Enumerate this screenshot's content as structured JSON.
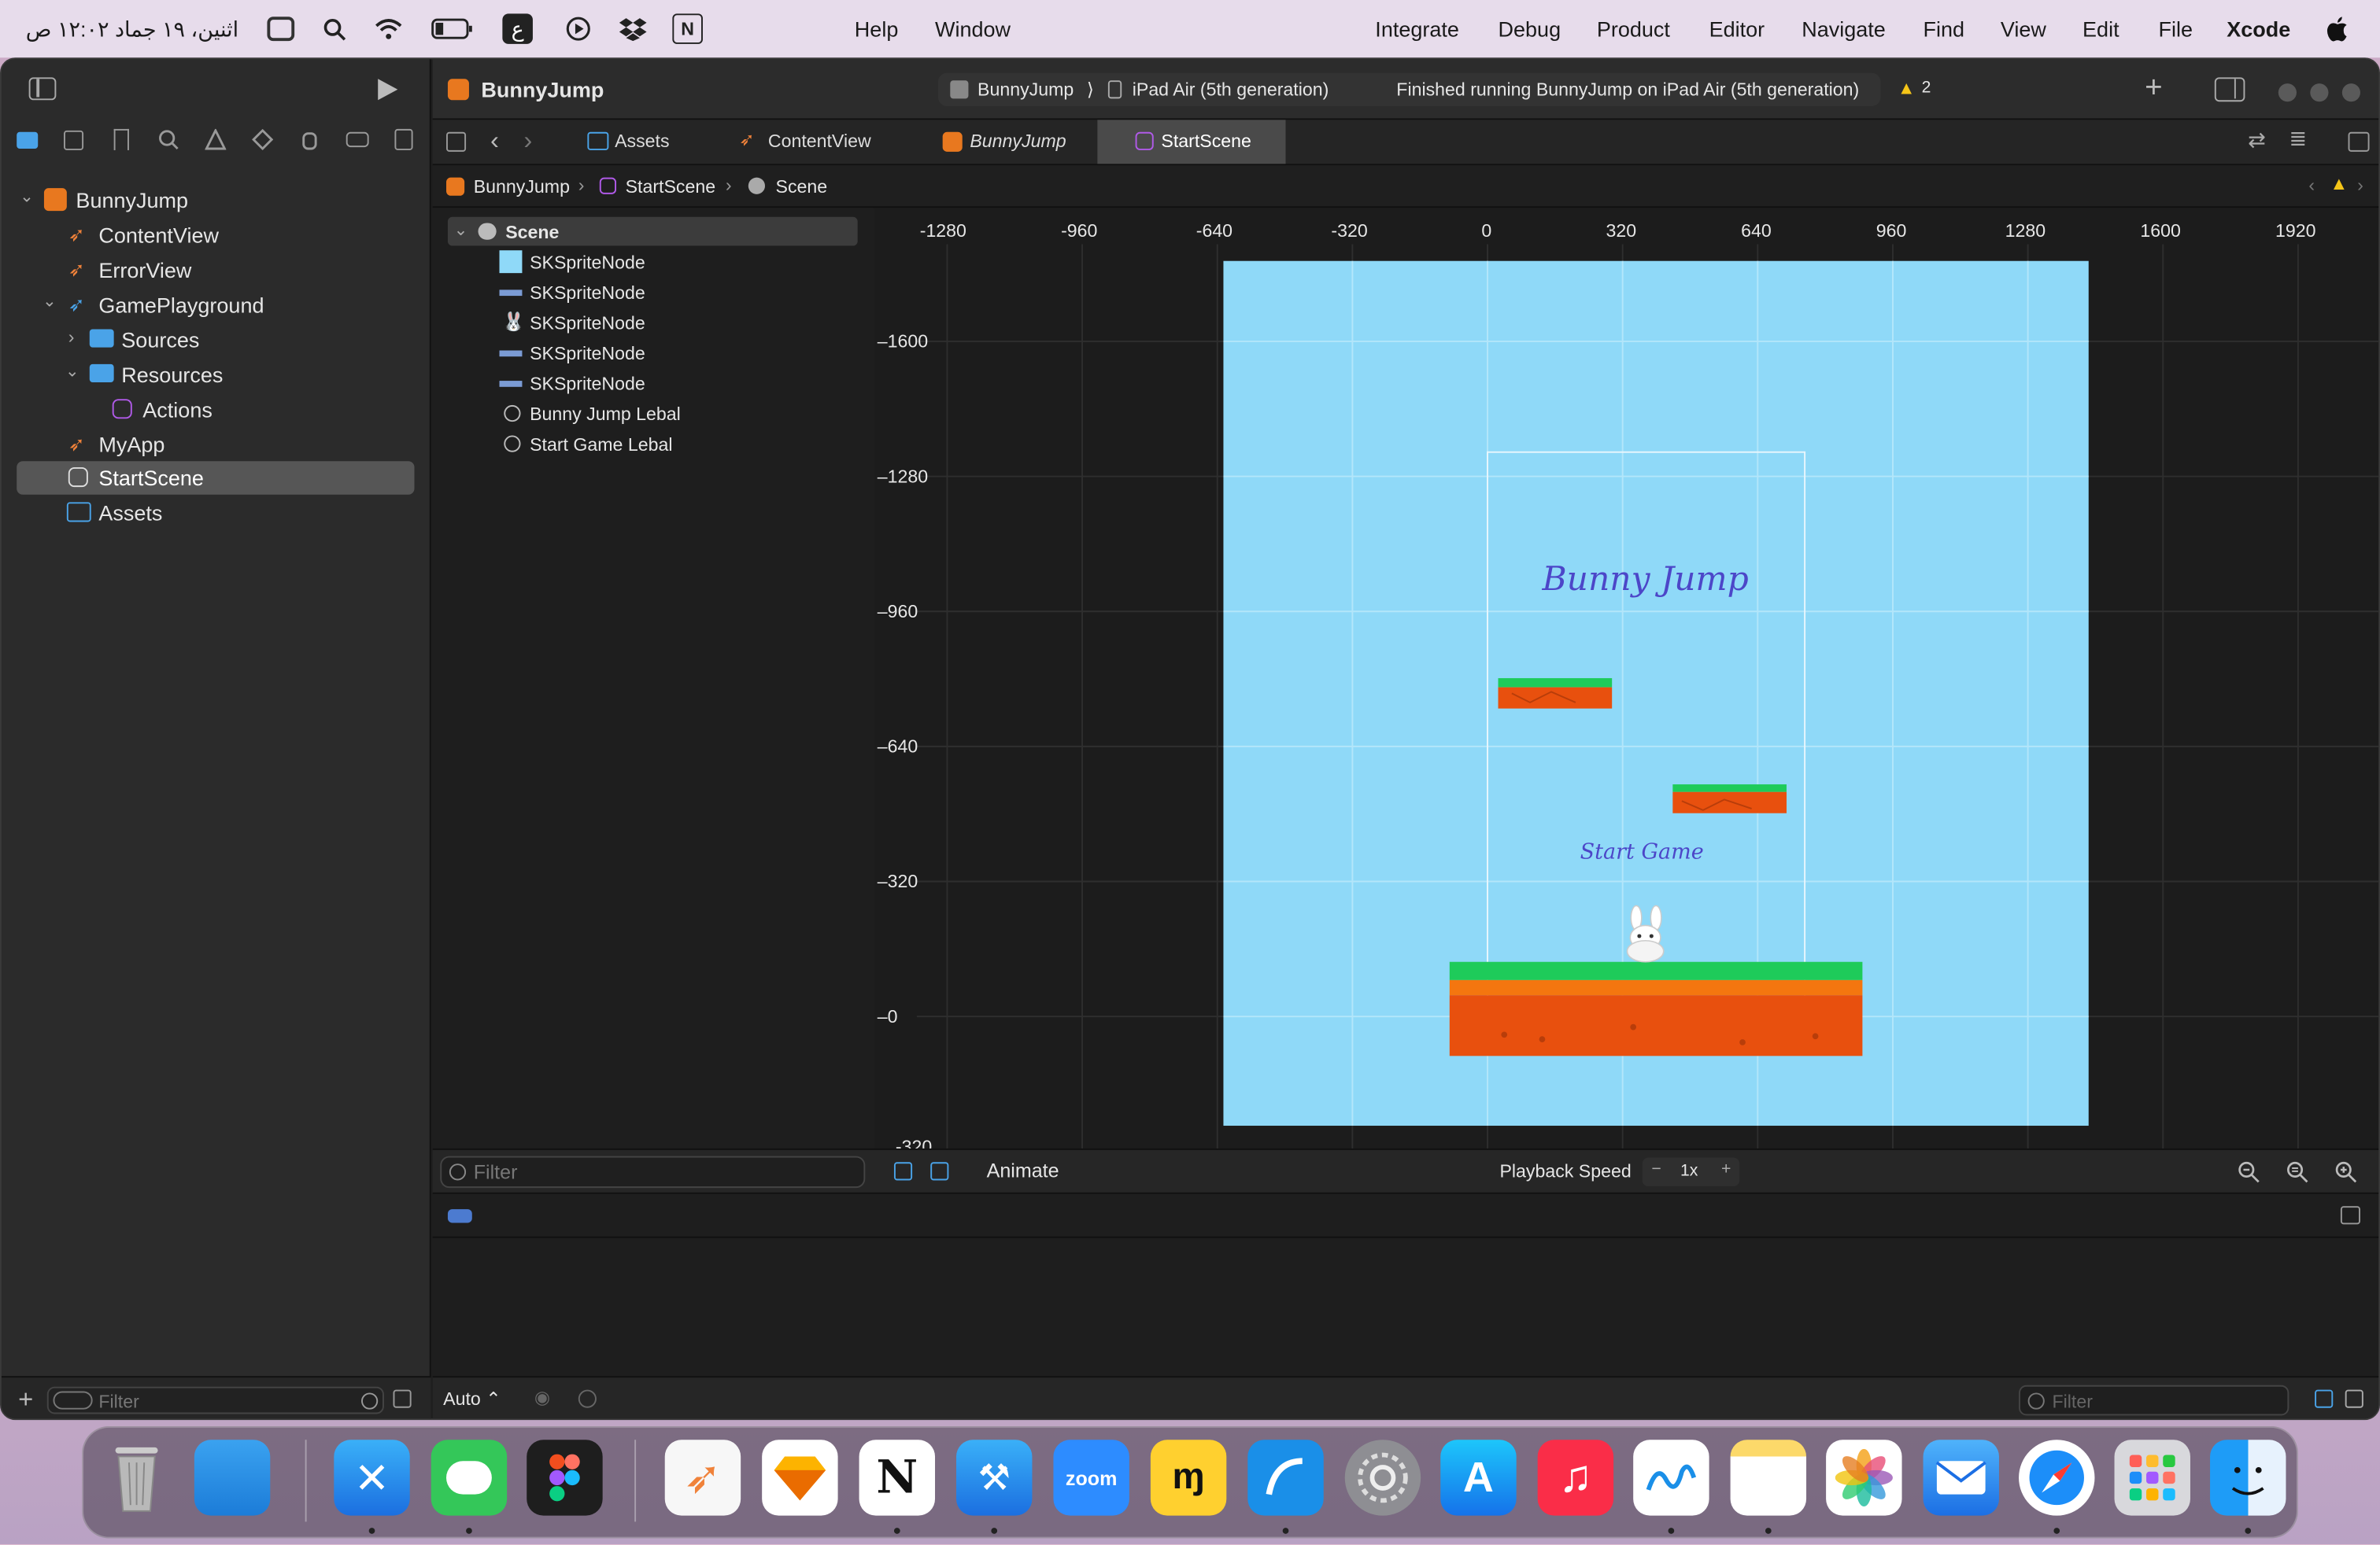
{
  "menubar": {
    "apple": "",
    "app": "Xcode",
    "items": [
      "File",
      "Edit",
      "View",
      "Find",
      "Navigate",
      "Editor",
      "Product",
      "Debug",
      "Integrate"
    ],
    "right_items": [
      "Window",
      "Help"
    ],
    "clock": "اثنين، ١٩ جماد ١٢:٠٢ ص",
    "lang_indicator": "ع",
    "notion": "N"
  },
  "toolbar": {
    "project": "BunnyJump",
    "scheme": "BunnyJump",
    "scheme_sep": "⟩",
    "device": "iPad Air (5th generation)",
    "status": "Finished running BunnyJump on iPad Air (5th generation)",
    "warnings": "2",
    "add": "+"
  },
  "tabs": [
    {
      "label": "Assets",
      "icon": "assets-icon"
    },
    {
      "label": "ContentView",
      "icon": "swift-icon"
    },
    {
      "label": "BunnyJump",
      "icon": "project-icon"
    },
    {
      "label": "StartScene",
      "icon": "scene-icon"
    }
  ],
  "jumpbar": [
    "BunnyJump",
    "StartScene",
    "Scene"
  ],
  "navigator": {
    "items": [
      {
        "label": "BunnyJump",
        "indent": 0,
        "disclosure": "⌄"
      },
      {
        "label": "ContentView",
        "indent": 1
      },
      {
        "label": "ErrorView",
        "indent": 1
      },
      {
        "label": "GamePlayground",
        "indent": 1,
        "disclosure": "⌄"
      },
      {
        "label": "Sources",
        "indent": 2,
        "disclosure": "›"
      },
      {
        "label": "Resources",
        "indent": 2,
        "disclosure": "⌄"
      },
      {
        "label": "Actions",
        "indent": 3
      },
      {
        "label": "MyApp",
        "indent": 1
      },
      {
        "label": "StartScene",
        "indent": 1
      },
      {
        "label": "Assets",
        "indent": 1
      }
    ],
    "filter_placeholder": "Filter",
    "add": "+"
  },
  "outline": {
    "root": "Scene",
    "nodes": [
      "SKSpriteNode",
      "SKSpriteNode",
      "SKSpriteNode",
      "SKSpriteNode",
      "SKSpriteNode",
      "Bunny Jump Lebal",
      "Start Game Lebal"
    ],
    "filter_placeholder": "Filter"
  },
  "ruler": {
    "x": [
      "-1280",
      "-960",
      "-640",
      "-320",
      "0",
      "320",
      "640",
      "960",
      "1280",
      "1600",
      "1920"
    ],
    "y": [
      "1600",
      "1280",
      "960",
      "640",
      "320",
      "0",
      "-320"
    ]
  },
  "scene": {
    "title": "Bunny Jump",
    "start_label": "Start Game",
    "sky_color": "#8fd9f8",
    "grass_color": "#1ecb5a",
    "dirt_color": "#e8500e"
  },
  "bottombar": {
    "animate": "Animate",
    "playback_label": "Playback Speed",
    "minus": "−",
    "speed": "1x",
    "plus": "+"
  },
  "status": {
    "auto": "Auto ⌃",
    "filter_placeholder": "Filter"
  },
  "dock": {
    "zoom_label": "zoom",
    "notion_label": "N"
  }
}
